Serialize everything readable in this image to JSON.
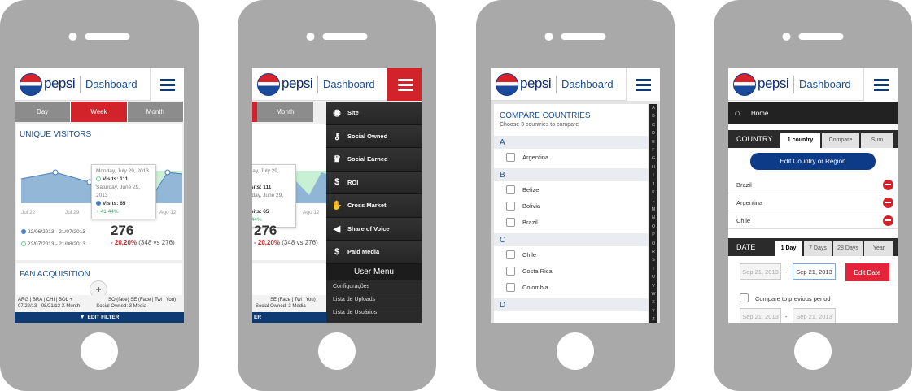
{
  "header": {
    "brand": "pepsi",
    "title": "Dashboard"
  },
  "screen1": {
    "tabs": [
      "Day",
      "Week",
      "Month"
    ],
    "active_tab": "Week",
    "unique_visitors_title": "UNIQUE VISITORS",
    "x_axis_labels": [
      "Jul 22",
      "Jul 29",
      "Ago 12"
    ],
    "tooltip": {
      "date1": "Monday, July 29, 2013",
      "visits1": "Visits: 111",
      "date2": "Saturday, June 29, 2013",
      "visits2": "Visits: 65",
      "change": "+ 41,44%"
    },
    "legend": [
      "22/06/2013 - 21/07/2013",
      "22/07/2013 - 21/08/2013"
    ],
    "total": "276",
    "delta_pct": "- 20,20%",
    "delta_detail": "(348 vs 276)",
    "fan_acquisition_title": "FAN ACQUISITION",
    "filter_line1_left": "ARG | BRA | CHI | BOL +",
    "filter_line2_left": "07/22/13 - 08/21/13 X Month",
    "filter_line1_right": "SO (face)   SE (Face | Twi | You)",
    "filter_line2_right": "Social Owned: 3 Media",
    "plus": "+",
    "edit_filter": "EDIT FILTER"
  },
  "screen2": {
    "menu_items": [
      {
        "icon": "globe-icon",
        "glyph": "◉",
        "label": "Site"
      },
      {
        "icon": "key-icon",
        "glyph": "⚷",
        "label": "Social Owned"
      },
      {
        "icon": "crown-icon",
        "glyph": "♛",
        "label": "Social Earned"
      },
      {
        "icon": "dollar-icon",
        "glyph": "$",
        "label": "ROI"
      },
      {
        "icon": "handshake-icon",
        "glyph": "✋",
        "label": "Cross Market"
      },
      {
        "icon": "megaphone-icon",
        "glyph": "◀",
        "label": "Share of Voice"
      },
      {
        "icon": "dollar-sign-icon",
        "glyph": "$",
        "label": "Paid Media"
      }
    ],
    "user_menu_title": "User Menu",
    "user_menu_items": [
      "Configurações",
      "Lista de Uploads",
      "Lista de Usuários"
    ],
    "partial_tab": "Month",
    "partial_filter_right": "SE (Face | Twi | You)",
    "partial_filter_right2": "Social Owned: 3 Media",
    "partial_edit": "ER"
  },
  "screen3": {
    "title": "COMPARE COUNTRIES",
    "subtitle": "Choose 3 countries to compare",
    "groups": [
      {
        "letter": "A",
        "countries": [
          "Argentina"
        ]
      },
      {
        "letter": "B",
        "countries": [
          "Belize",
          "Bolivia",
          "Brazil"
        ]
      },
      {
        "letter": "C",
        "countries": [
          "Chile",
          "Costa Rica",
          "Colombia"
        ]
      },
      {
        "letter": "D",
        "countries": []
      }
    ],
    "alphabet": "ABCDEFGHIJKLMNOPQRSTUVWXYZ"
  },
  "screen4": {
    "home": "Home",
    "country_label": "COUNTRY",
    "country_tabs": [
      "1 country",
      "Compare",
      "Sum"
    ],
    "edit_country_btn": "Edit Country or Region",
    "countries": [
      "Brazil",
      "Argentina",
      "Chile"
    ],
    "date_label": "DATE",
    "date_tabs": [
      "1 Day",
      "7 Days",
      "28 Days",
      "Year"
    ],
    "date_from": "Sep 21, 2013",
    "date_to": "Sep 21, 2013",
    "dash": "-",
    "edit_date_btn": "Edit Date",
    "compare_label": "Compare to previous period",
    "prev_from": "Sep 21, 2013",
    "prev_to": "Sep 21, 2013"
  },
  "colors": {
    "pepsi_blue": "#0e3b74",
    "accent_red": "#d2232a",
    "link_blue": "#1d4f91"
  }
}
